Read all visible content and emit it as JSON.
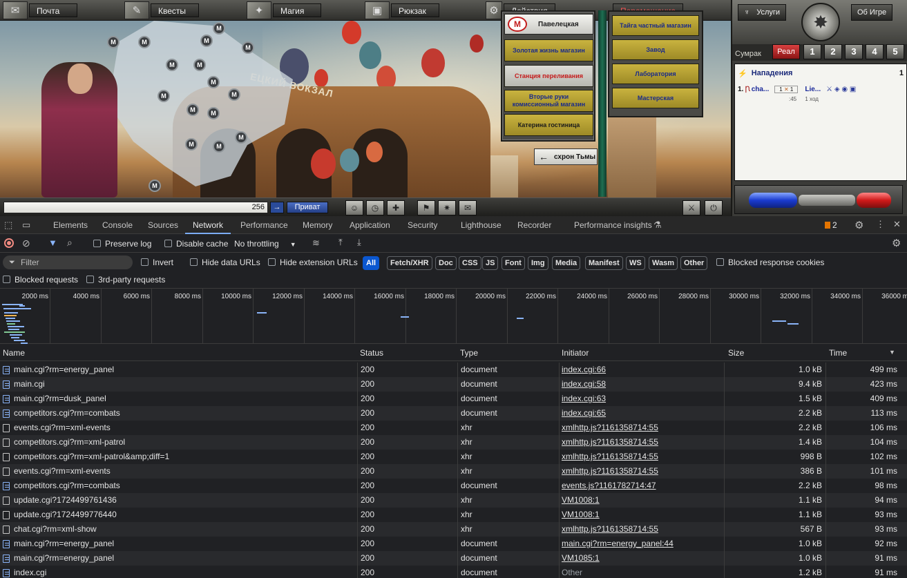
{
  "game": {
    "top_tabs": [
      {
        "label": "Почта",
        "icon": "mail-icon"
      },
      {
        "label": "Квесты",
        "icon": "quests-icon"
      },
      {
        "label": "Магия",
        "icon": "magic-icon"
      },
      {
        "label": "Рюкзак",
        "icon": "backpack-icon"
      },
      {
        "label": "Действия",
        "icon": "actions-icon"
      },
      {
        "label": "Перемещение",
        "icon": "travel-icon"
      }
    ],
    "station_sign": "ЕЦКИЙ ВОКЗАЛ",
    "location": {
      "metro_symbol": "М",
      "title": "Павелецкая",
      "buttons": [
        {
          "label": "Золотая жизнь магазин"
        },
        {
          "label": "Станция переливания"
        },
        {
          "label": "Вторые руки комиссионный магазин"
        },
        {
          "label": "Катерина гостиница"
        }
      ]
    },
    "shops": [
      {
        "label": "Тайга частный магазин"
      },
      {
        "label": "Завод"
      },
      {
        "label": "Лаборатория"
      },
      {
        "label": "Мастерская"
      }
    ],
    "back_sign": "схрон Тьмы",
    "metro_marker": "M",
    "chat": {
      "counter": "256",
      "send": "→",
      "private_label": "Приват"
    },
    "right_panel": {
      "services_label": "Услуги",
      "about_label": "Об Игре",
      "twilight_label": "Сумрак",
      "real_label": "Реал",
      "levels": [
        "1",
        "2",
        "3",
        "4",
        "5"
      ],
      "attacks_title": "Нападения",
      "attacks_count": "1",
      "attack_row": {
        "index": "1.",
        "name": "cha...",
        "target": "Lie...",
        "left_count": "1",
        "right_count": "1"
      },
      "attack_timer": ":45",
      "attack_moves": "1 ход"
    }
  },
  "devtools": {
    "tabs": [
      "Elements",
      "Console",
      "Sources",
      "Network",
      "Performance",
      "Memory",
      "Application",
      "Security",
      "Lighthouse",
      "Recorder",
      "Performance insights"
    ],
    "active_tab": "Network",
    "issues_count": "2",
    "toolbar": {
      "preserve_log": "Preserve log",
      "disable_cache": "Disable cache",
      "throttling": "No throttling"
    },
    "filter": {
      "placeholder": "Filter",
      "invert": "Invert",
      "hide_data_urls": "Hide data URLs",
      "hide_extension_urls": "Hide extension URLs",
      "types": [
        "All",
        "Fetch/XHR",
        "Doc",
        "CSS",
        "JS",
        "Font",
        "Img",
        "Media",
        "Manifest",
        "WS",
        "Wasm",
        "Other"
      ],
      "blocked_cookies": "Blocked response cookies",
      "blocked_requests": "Blocked requests",
      "third_party": "3rd-party requests"
    },
    "waterfall_ticks": [
      "2000 ms",
      "4000 ms",
      "6000 ms",
      "8000 ms",
      "10000 ms",
      "12000 ms",
      "14000 ms",
      "16000 ms",
      "18000 ms",
      "20000 ms",
      "22000 ms",
      "24000 ms",
      "26000 ms",
      "28000 ms",
      "30000 ms",
      "32000 ms",
      "34000 ms",
      "36000 ms"
    ],
    "columns": [
      "Name",
      "Status",
      "Type",
      "Initiator",
      "Size",
      "Time"
    ],
    "rows": [
      {
        "name": "main.cgi?rm=energy_panel",
        "status": "200",
        "type": "document",
        "initiator": "index.cgi:66",
        "size": "1.0 kB",
        "time": "499 ms"
      },
      {
        "name": "main.cgi",
        "status": "200",
        "type": "document",
        "initiator": "index.cgi:58",
        "size": "9.4 kB",
        "time": "423 ms"
      },
      {
        "name": "main.cgi?rm=dusk_panel",
        "status": "200",
        "type": "document",
        "initiator": "index.cgi:63",
        "size": "1.5 kB",
        "time": "409 ms"
      },
      {
        "name": "competitors.cgi?rm=combats",
        "status": "200",
        "type": "document",
        "initiator": "index.cgi:65",
        "size": "2.2 kB",
        "time": "113 ms"
      },
      {
        "name": "events.cgi?rm=xml-events",
        "status": "200",
        "type": "xhr",
        "initiator": "xmlhttp.js?1161358714:55",
        "size": "2.2 kB",
        "time": "106 ms"
      },
      {
        "name": "competitors.cgi?rm=xml-patrol",
        "status": "200",
        "type": "xhr",
        "initiator": "xmlhttp.js?1161358714:55",
        "size": "1.4 kB",
        "time": "104 ms"
      },
      {
        "name": "competitors.cgi?rm=xml-patrol&amp;diff=1",
        "status": "200",
        "type": "xhr",
        "initiator": "xmlhttp.js?1161358714:55",
        "size": "998 B",
        "time": "102 ms"
      },
      {
        "name": "events.cgi?rm=xml-events",
        "status": "200",
        "type": "xhr",
        "initiator": "xmlhttp.js?1161358714:55",
        "size": "386 B",
        "time": "101 ms"
      },
      {
        "name": "competitors.cgi?rm=combats",
        "status": "200",
        "type": "document",
        "initiator": "events.js?1161782714:47",
        "size": "2.2 kB",
        "time": "98 ms"
      },
      {
        "name": "update.cgi?1724499761436",
        "status": "200",
        "type": "xhr",
        "initiator": "VM1008:1",
        "size": "1.1 kB",
        "time": "94 ms"
      },
      {
        "name": "update.cgi?1724499776440",
        "status": "200",
        "type": "xhr",
        "initiator": "VM1008:1",
        "size": "1.1 kB",
        "time": "93 ms"
      },
      {
        "name": "chat.cgi?rm=xml-show",
        "status": "200",
        "type": "xhr",
        "initiator": "xmlhttp.js?1161358714:55",
        "size": "567 B",
        "time": "93 ms"
      },
      {
        "name": "main.cgi?rm=energy_panel",
        "status": "200",
        "type": "document",
        "initiator": "main.cgi?rm=energy_panel:44",
        "size": "1.0 kB",
        "time": "92 ms"
      },
      {
        "name": "main.cgi?rm=energy_panel",
        "status": "200",
        "type": "document",
        "initiator": "VM1085:1",
        "size": "1.0 kB",
        "time": "91 ms"
      },
      {
        "name": "index.cgi",
        "status": "200",
        "type": "document",
        "initiator": "Other",
        "size": "1.2 kB",
        "time": "91 ms"
      }
    ]
  }
}
